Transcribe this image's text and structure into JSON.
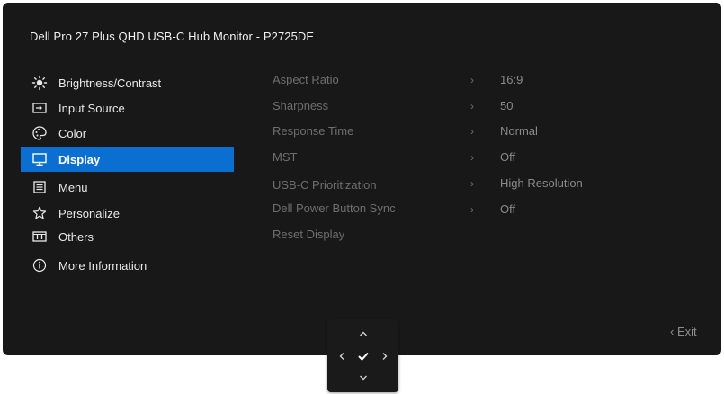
{
  "osd": {
    "title": "Dell Pro 27 Plus QHD USB-C Hub Monitor - P2725DE",
    "exit_label": "Exit",
    "accent_color": "#0a6fd0"
  },
  "menu": {
    "items": [
      {
        "label": "Brightness/Contrast",
        "icon": "brightness-icon"
      },
      {
        "label": "Input Source",
        "icon": "input-source-icon"
      },
      {
        "label": "Color",
        "icon": "color-palette-icon"
      },
      {
        "label": "Display",
        "icon": "display-icon",
        "selected": true
      },
      {
        "label": "Menu",
        "icon": "menu-icon"
      },
      {
        "label": "Personalize",
        "icon": "star-icon"
      },
      {
        "label": "Others",
        "icon": "others-icon"
      },
      {
        "label": "More Information",
        "icon": "info-icon"
      }
    ]
  },
  "submenu": {
    "items": [
      {
        "label": "Aspect Ratio",
        "value": "16:9"
      },
      {
        "label": "Sharpness",
        "value": "50"
      },
      {
        "label": "Response Time",
        "value": "Normal"
      },
      {
        "label": "MST",
        "value": "Off"
      },
      {
        "label": "USB-C Prioritization",
        "value": "High Resolution"
      },
      {
        "label": "Dell Power Button Sync",
        "value": "Off"
      },
      {
        "label": "Reset Display"
      }
    ],
    "chevron": "›"
  },
  "joystick": {
    "up": "up-arrow-icon",
    "down": "down-arrow-icon",
    "left": "left-arrow-icon",
    "right": "right-arrow-icon",
    "ok": "checkmark-icon"
  }
}
